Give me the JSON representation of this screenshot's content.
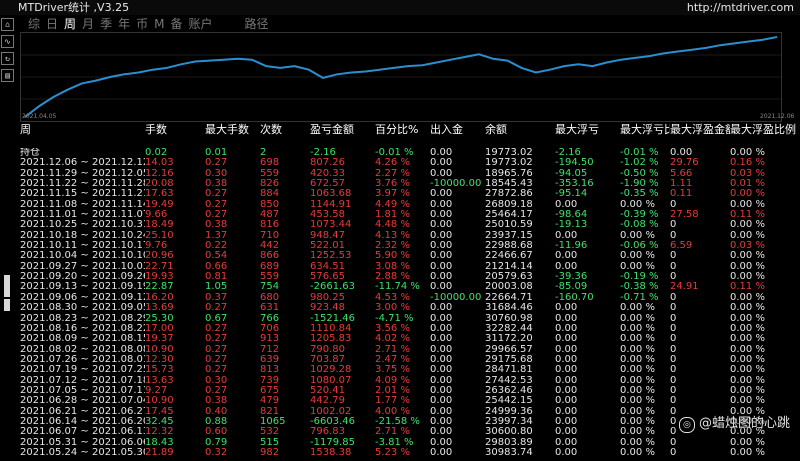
{
  "window": {
    "title": "MTDriver统计 ,V3.25",
    "url": "http://mtdriver.com"
  },
  "tabs": [
    {
      "label": "综",
      "active": false
    },
    {
      "label": "日",
      "active": false
    },
    {
      "label": "周",
      "active": true
    },
    {
      "label": "月",
      "active": false
    },
    {
      "label": "季",
      "active": false
    },
    {
      "label": "年",
      "active": false
    },
    {
      "label": "币",
      "active": false
    },
    {
      "label": "M",
      "active": false
    },
    {
      "label": "备",
      "active": false
    },
    {
      "label": "账户",
      "active": false
    },
    {
      "label": "路径",
      "active": false
    }
  ],
  "toolbar": [
    {
      "name": "tool-home-icon",
      "glyph": "⌂"
    },
    {
      "name": "tool-chart-icon",
      "glyph": "∿"
    },
    {
      "name": "tool-refresh-icon",
      "glyph": "↻"
    },
    {
      "name": "tool-folder-icon",
      "glyph": "▤"
    }
  ],
  "chart_data": {
    "type": "line",
    "x_start_label": "2021.04.05",
    "x_end_label": "2021.12.06",
    "series_color": "#2a8fd0",
    "values": [
      6,
      18,
      28,
      36,
      43,
      46,
      50,
      53,
      55,
      58,
      60,
      64,
      67,
      68,
      69,
      70,
      69,
      62,
      60,
      62,
      58,
      49,
      53,
      55,
      56,
      58,
      60,
      62,
      63,
      66,
      69,
      72,
      75,
      70,
      68,
      60,
      55,
      58,
      62,
      64,
      62,
      66,
      69,
      71,
      73,
      76,
      78,
      80,
      82,
      85,
      87,
      89,
      91,
      94
    ]
  },
  "columns": [
    "周",
    "手数",
    "最大手数",
    "次数",
    "盈亏金额",
    "百分比%",
    "出入金",
    "余额",
    "最大浮亏",
    "最大浮亏比",
    "最大浮盈金额",
    "最大浮盈比例"
  ],
  "rows": [
    {
      "period": "持仓",
      "lots": "0.02",
      "maxlots": "0.01",
      "count": "2",
      "pnl": "-2.16",
      "pct": "-0.01 %",
      "io": "0.00",
      "balance": "19773.02",
      "maxloss": "-2.16",
      "maxlosspct": "-0.01 %",
      "maxgain": "0.00",
      "maxgainpct": "0.00 %",
      "sign": "g"
    },
    {
      "period": "2021.12.06 ~ 2021.12.12",
      "lots": "14.03",
      "maxlots": "0.27",
      "count": "698",
      "pnl": "807.26",
      "pct": "4.26 %",
      "io": "0.00",
      "balance": "19773.02",
      "maxloss": "-194.50",
      "maxlosspct": "-1.02 %",
      "maxgain": "29.76",
      "maxgainpct": "0.16 %",
      "sign": "r"
    },
    {
      "period": "2021.11.29 ~ 2021.12.05",
      "lots": "12.16",
      "maxlots": "0.30",
      "count": "559",
      "pnl": "420.33",
      "pct": "2.27 %",
      "io": "0.00",
      "balance": "18965.76",
      "maxloss": "-94.05",
      "maxlosspct": "-0.50 %",
      "maxgain": "5.66",
      "maxgainpct": "0.03 %",
      "sign": "r"
    },
    {
      "period": "2021.11.22 ~ 2021.11.28",
      "lots": "20.08",
      "maxlots": "0.38",
      "count": "826",
      "pnl": "672.57",
      "pct": "3.76 %",
      "io": "-10000.00",
      "balance": "18545.43",
      "maxloss": "-353.16",
      "maxlosspct": "-1.90 %",
      "maxgain": "1.11",
      "maxgainpct": "0.01 %",
      "sign": "r"
    },
    {
      "period": "2021.11.15 ~ 2021.11.21",
      "lots": "17.63",
      "maxlots": "0.27",
      "count": "884",
      "pnl": "1063.68",
      "pct": "3.97 %",
      "io": "0.00",
      "balance": "27872.86",
      "maxloss": "-95.14",
      "maxlosspct": "-0.35 %",
      "maxgain": "0.11",
      "maxgainpct": "0.00 %",
      "sign": "r"
    },
    {
      "period": "2021.11.08 ~ 2021.11.14",
      "lots": "19.49",
      "maxlots": "0.27",
      "count": "850",
      "pnl": "1144.91",
      "pct": "4.49 %",
      "io": "0.00",
      "balance": "26809.18",
      "maxloss": "0.00",
      "maxlosspct": "0.00 %",
      "maxgain": "0",
      "maxgainpct": "0.00 %",
      "sign": "r"
    },
    {
      "period": "2021.11.01 ~ 2021.11.07",
      "lots": "9.66",
      "maxlots": "0.27",
      "count": "487",
      "pnl": "453.58",
      "pct": "1.81 %",
      "io": "0.00",
      "balance": "25464.17",
      "maxloss": "-98.64",
      "maxlosspct": "-0.39 %",
      "maxgain": "27.58",
      "maxgainpct": "0.11 %",
      "sign": "r"
    },
    {
      "period": "2021.10.25 ~ 2021.10.31",
      "lots": "18.49",
      "maxlots": "0.38",
      "count": "816",
      "pnl": "1073.44",
      "pct": "4.48 %",
      "io": "0.00",
      "balance": "25010.59",
      "maxloss": "-19.13",
      "maxlosspct": "-0.08 %",
      "maxgain": "0",
      "maxgainpct": "0.00 %",
      "sign": "r"
    },
    {
      "period": "2021.10.18 ~ 2021.10.24",
      "lots": "25.10",
      "maxlots": "1.37",
      "count": "710",
      "pnl": "948.47",
      "pct": "4.13 %",
      "io": "0.00",
      "balance": "23937.15",
      "maxloss": "0.00",
      "maxlosspct": "0.00 %",
      "maxgain": "0",
      "maxgainpct": "0.00 %",
      "sign": "r"
    },
    {
      "period": "2021.10.11 ~ 2021.10.17",
      "lots": "9.76",
      "maxlots": "0.22",
      "count": "442",
      "pnl": "522.01",
      "pct": "2.32 %",
      "io": "0.00",
      "balance": "22988.68",
      "maxloss": "-11.96",
      "maxlosspct": "-0.06 %",
      "maxgain": "6.59",
      "maxgainpct": "0.03 %",
      "sign": "r"
    },
    {
      "period": "2021.10.04 ~ 2021.10.10",
      "lots": "20.96",
      "maxlots": "0.54",
      "count": "866",
      "pnl": "1252.53",
      "pct": "5.90 %",
      "io": "0.00",
      "balance": "22466.67",
      "maxloss": "0.00",
      "maxlosspct": "0.00 %",
      "maxgain": "0",
      "maxgainpct": "0.00 %",
      "sign": "r"
    },
    {
      "period": "2021.09.27 ~ 2021.10.03",
      "lots": "22.71",
      "maxlots": "0.66",
      "count": "689",
      "pnl": "634.51",
      "pct": "3.08 %",
      "io": "0.00",
      "balance": "21214.14",
      "maxloss": "0.00",
      "maxlosspct": "0.00 %",
      "maxgain": "0",
      "maxgainpct": "0.00 %",
      "sign": "r"
    },
    {
      "period": "2021.09.20 ~ 2021.09.26",
      "lots": "19.93",
      "maxlots": "0.81",
      "count": "559",
      "pnl": "576.65",
      "pct": "2.88 %",
      "io": "0.00",
      "balance": "20579.63",
      "maxloss": "-39.36",
      "maxlosspct": "-0.19 %",
      "maxgain": "0",
      "maxgainpct": "0.00 %",
      "sign": "r"
    },
    {
      "period": "2021.09.13 ~ 2021.09.19",
      "lots": "22.87",
      "maxlots": "1.05",
      "count": "754",
      "pnl": "-2661.63",
      "pct": "-11.74 %",
      "io": "0.00",
      "balance": "20003.08",
      "maxloss": "-85.09",
      "maxlosspct": "-0.38 %",
      "maxgain": "24.91",
      "maxgainpct": "0.11 %",
      "sign": "g"
    },
    {
      "period": "2021.09.06 ~ 2021.09.12",
      "lots": "16.20",
      "maxlots": "0.37",
      "count": "680",
      "pnl": "980.25",
      "pct": "4.53 %",
      "io": "-10000.00",
      "balance": "22664.71",
      "maxloss": "-160.70",
      "maxlosspct": "-0.71 %",
      "maxgain": "0",
      "maxgainpct": "0.00 %",
      "sign": "r"
    },
    {
      "period": "2021.08.30 ~ 2021.09.05",
      "lots": "13.69",
      "maxlots": "0.27",
      "count": "631",
      "pnl": "923.48",
      "pct": "3.00 %",
      "io": "0.00",
      "balance": "31684.46",
      "maxloss": "0.00",
      "maxlosspct": "0.00 %",
      "maxgain": "0",
      "maxgainpct": "0.00 %",
      "sign": "r"
    },
    {
      "period": "2021.08.23 ~ 2021.08.29",
      "lots": "25.30",
      "maxlots": "0.67",
      "count": "766",
      "pnl": "-1521.46",
      "pct": "-4.71 %",
      "io": "0.00",
      "balance": "30760.98",
      "maxloss": "0.00",
      "maxlosspct": "0.00 %",
      "maxgain": "0",
      "maxgainpct": "0.00 %",
      "sign": "g"
    },
    {
      "period": "2021.08.16 ~ 2021.08.22",
      "lots": "17.00",
      "maxlots": "0.27",
      "count": "706",
      "pnl": "1110.84",
      "pct": "3.56 %",
      "io": "0.00",
      "balance": "32282.44",
      "maxloss": "0.00",
      "maxlosspct": "0.00 %",
      "maxgain": "0",
      "maxgainpct": "0.00 %",
      "sign": "r"
    },
    {
      "period": "2021.08.09 ~ 2021.08.15",
      "lots": "19.37",
      "maxlots": "0.27",
      "count": "913",
      "pnl": "1205.83",
      "pct": "4.02 %",
      "io": "0.00",
      "balance": "31172.20",
      "maxloss": "0.00",
      "maxlosspct": "0.00 %",
      "maxgain": "0",
      "maxgainpct": "0.00 %",
      "sign": "r"
    },
    {
      "period": "2021.08.02 ~ 2021.08.08",
      "lots": "10.90",
      "maxlots": "0.27",
      "count": "712",
      "pnl": "790.80",
      "pct": "2.71 %",
      "io": "0.00",
      "balance": "29966.57",
      "maxloss": "0.00",
      "maxlosspct": "0.00 %",
      "maxgain": "0",
      "maxgainpct": "0.00 %",
      "sign": "r"
    },
    {
      "period": "2021.07.26 ~ 2021.08.01",
      "lots": "12.30",
      "maxlots": "0.27",
      "count": "639",
      "pnl": "703.87",
      "pct": "2.47 %",
      "io": "0.00",
      "balance": "29175.68",
      "maxloss": "0.00",
      "maxlosspct": "0.00 %",
      "maxgain": "0",
      "maxgainpct": "0.00 %",
      "sign": "r"
    },
    {
      "period": "2021.07.19 ~ 2021.07.25",
      "lots": "15.73",
      "maxlots": "0.27",
      "count": "813",
      "pnl": "1029.28",
      "pct": "3.75 %",
      "io": "0.00",
      "balance": "28471.81",
      "maxloss": "0.00",
      "maxlosspct": "0.00 %",
      "maxgain": "0",
      "maxgainpct": "0.00 %",
      "sign": "r"
    },
    {
      "period": "2021.07.12 ~ 2021.07.18",
      "lots": "13.63",
      "maxlots": "0.30",
      "count": "739",
      "pnl": "1080.07",
      "pct": "4.09 %",
      "io": "0.00",
      "balance": "27442.53",
      "maxloss": "0.00",
      "maxlosspct": "0.00 %",
      "maxgain": "0",
      "maxgainpct": "0.00 %",
      "sign": "r"
    },
    {
      "period": "2021.07.05 ~ 2021.07.11",
      "lots": "9.27",
      "maxlots": "0.27",
      "count": "675",
      "pnl": "520.41",
      "pct": "2.01 %",
      "io": "0.00",
      "balance": "26362.46",
      "maxloss": "0.00",
      "maxlosspct": "0.00 %",
      "maxgain": "0",
      "maxgainpct": "0.00 %",
      "sign": "r"
    },
    {
      "period": "2021.06.28 ~ 2021.07.04",
      "lots": "10.90",
      "maxlots": "0.38",
      "count": "479",
      "pnl": "442.79",
      "pct": "1.77 %",
      "io": "0.00",
      "balance": "25442.15",
      "maxloss": "0.00",
      "maxlosspct": "0.00 %",
      "maxgain": "0",
      "maxgainpct": "0.00 %",
      "sign": "r"
    },
    {
      "period": "2021.06.21 ~ 2021.06.27",
      "lots": "17.45",
      "maxlots": "0.40",
      "count": "821",
      "pnl": "1002.02",
      "pct": "4.00 %",
      "io": "0.00",
      "balance": "24999.36",
      "maxloss": "0.00",
      "maxlosspct": "0.00 %",
      "maxgain": "0",
      "maxgainpct": "0.00 %",
      "sign": "r"
    },
    {
      "period": "2021.06.14 ~ 2021.06.20",
      "lots": "32.45",
      "maxlots": "0.88",
      "count": "1065",
      "pnl": "-6603.46",
      "pct": "-21.58 %",
      "io": "0.00",
      "balance": "23997.34",
      "maxloss": "0.00",
      "maxlosspct": "0.00 %",
      "maxgain": "0",
      "maxgainpct": "0.00 %",
      "sign": "g"
    },
    {
      "period": "2021.06.07 ~ 2021.06.13",
      "lots": "12.32",
      "maxlots": "0.60",
      "count": "532",
      "pnl": "796.83",
      "pct": "2.71 %",
      "io": "0.00",
      "balance": "30600.80",
      "maxloss": "0.00",
      "maxlosspct": "0.00 %",
      "maxgain": "0",
      "maxgainpct": "0.00 %",
      "sign": "r"
    },
    {
      "period": "2021.05.31 ~ 2021.06.06",
      "lots": "18.43",
      "maxlots": "0.79",
      "count": "515",
      "pnl": "-1179.85",
      "pct": "-3.81 %",
      "io": "0.00",
      "balance": "29803.89",
      "maxloss": "0.00",
      "maxlosspct": "0.00 %",
      "maxgain": "0",
      "maxgainpct": "0.00 %",
      "sign": "g"
    },
    {
      "period": "2021.05.24 ~ 2021.05.30",
      "lots": "21.89",
      "maxlots": "0.32",
      "count": "982",
      "pnl": "1538.38",
      "pct": "5.23 %",
      "io": "0.00",
      "balance": "30983.74",
      "maxloss": "0.00",
      "maxlosspct": "0.00 %",
      "maxgain": "0",
      "maxgainpct": "0.00 %",
      "sign": "r"
    }
  ],
  "watermark": {
    "text": "@蜡烛图的心跳"
  }
}
